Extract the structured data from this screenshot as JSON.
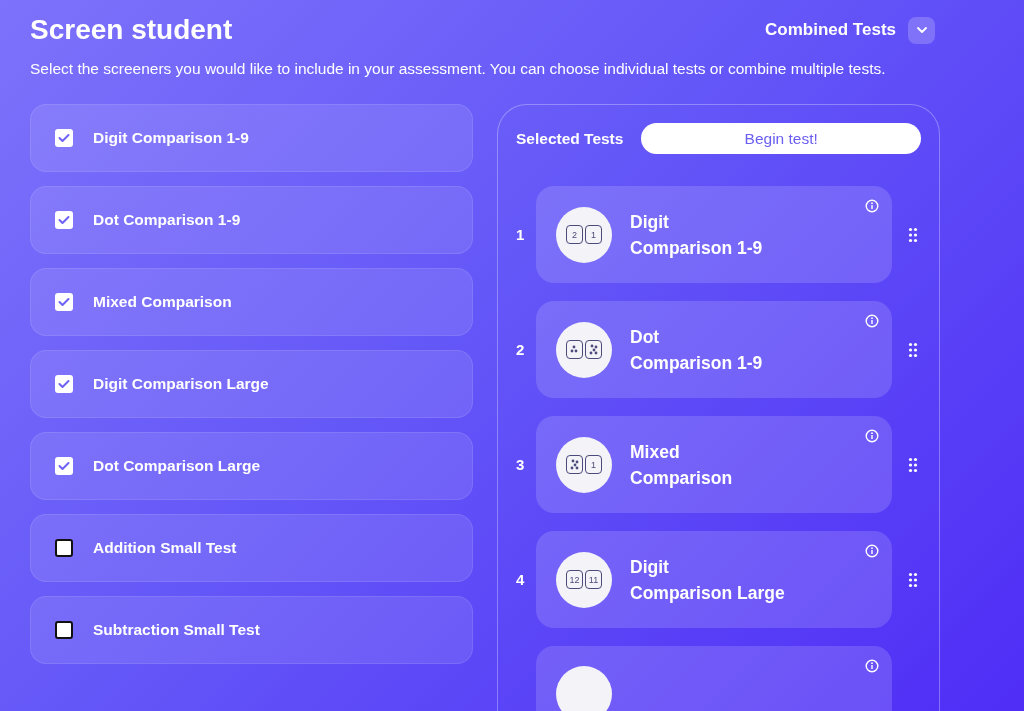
{
  "header": {
    "title": "Screen student",
    "mode": "Combined Tests",
    "description": "Select the screeners you would like to include in your assessment. You can choose individual tests or combine multiple tests."
  },
  "screeners": [
    {
      "label": "Digit Comparison 1-9",
      "checked": true
    },
    {
      "label": "Dot Comparison 1-9",
      "checked": true
    },
    {
      "label": "Mixed Comparison",
      "checked": true
    },
    {
      "label": "Digit Comparison Large",
      "checked": true
    },
    {
      "label": "Dot Comparison Large",
      "checked": true
    },
    {
      "label": "Addition Small Test",
      "checked": false
    },
    {
      "label": "Subtraction Small Test",
      "checked": false
    }
  ],
  "selected": {
    "heading": "Selected Tests",
    "button": "Begin test!",
    "more_below": true,
    "tests": [
      {
        "number": "1",
        "line1": "Digit",
        "line2": "Comparison 1-9",
        "tiles": [
          {
            "kind": "digit",
            "text": "2"
          },
          {
            "kind": "digit",
            "text": "1"
          }
        ]
      },
      {
        "number": "2",
        "line1": "Dot",
        "line2": "Comparison 1-9",
        "tiles": [
          {
            "kind": "dots-few"
          },
          {
            "kind": "dots-many"
          }
        ]
      },
      {
        "number": "3",
        "line1": "Mixed",
        "line2": "Comparison",
        "tiles": [
          {
            "kind": "dots-many"
          },
          {
            "kind": "digit",
            "text": "1"
          }
        ]
      },
      {
        "number": "4",
        "line1": "Digit",
        "line2": "Comparison Large",
        "tiles": [
          {
            "kind": "digit",
            "text": "12"
          },
          {
            "kind": "digit",
            "text": "11"
          }
        ]
      }
    ]
  }
}
